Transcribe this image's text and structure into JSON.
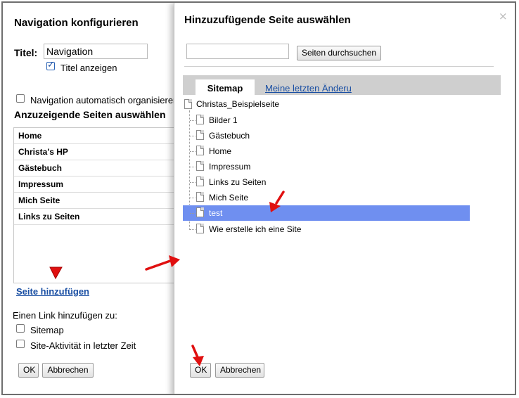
{
  "left_dialog": {
    "title": "Navigation konfigurieren",
    "titel_label": "Titel:",
    "titel_value": "Navigation",
    "show_title_label": "Titel anzeigen",
    "auto_organize_label": "Navigation automatisch organisieren",
    "pages_heading": "Anzuzeigende Seiten auswählen",
    "pages": [
      "Home",
      "Christa's HP",
      "Gästebuch",
      "Impressum",
      "Mich Seite",
      "Links zu Seiten"
    ],
    "add_page_link": "Seite hinzufügen",
    "add_link_heading": "Einen Link hinzufügen zu:",
    "link_options": [
      "Sitemap",
      "Site-Aktivität in letzter Zeit"
    ],
    "ok_label": "OK",
    "cancel_label": "Abbrechen"
  },
  "right_dialog": {
    "title": "Hinzuzufügende Seite auswählen",
    "close_icon": "close-icon",
    "search_button": "Seiten durchsuchen",
    "search_value": "",
    "tabs": {
      "active": "Sitemap",
      "other": "Meine letzten Änderu"
    },
    "tree_root": "Christas_Beispielseite",
    "tree_items": [
      "Bilder 1",
      "Gästebuch",
      "Home",
      "Impressum",
      "Links zu Seiten",
      "Mich Seite",
      "test",
      "Wie erstelle ich eine Site"
    ],
    "selected_item": "test",
    "ok_label": "OK",
    "cancel_label": "Abbrechen"
  },
  "colors": {
    "selection": "#6f8ff0",
    "link": "#1a4fa3",
    "annotation_arrow": "#e01010"
  }
}
